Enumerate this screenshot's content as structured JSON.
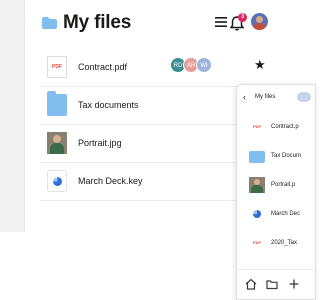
{
  "header": {
    "title": "My files",
    "notification_count": "3"
  },
  "files": [
    {
      "name": "Contract.pdf",
      "type": "pdf",
      "type_label": "PDF",
      "shared_with": [
        "RD",
        "AR",
        "WI"
      ],
      "starred": true
    },
    {
      "name": "Tax documents",
      "type": "folder"
    },
    {
      "name": "Portrait.jpg",
      "type": "image"
    },
    {
      "name": "March Deck.key",
      "type": "keynote"
    }
  ],
  "share_avatar_colors": [
    "#3a8f8f",
    "#e89c9c",
    "#9db4dd"
  ],
  "sidepanel": {
    "breadcrumb": "My files",
    "items": [
      {
        "name": "Contract.p",
        "type_label": "PDF"
      },
      {
        "name": "Tax Docum"
      },
      {
        "name": "Portrait.p"
      },
      {
        "name": "March Dec"
      },
      {
        "name": "2020_Tax",
        "type_label": "PDF"
      }
    ],
    "bottom_icons": [
      "home-icon",
      "folder-icon",
      "plus-icon"
    ]
  },
  "colors": {
    "folder_blue": "#82bdf0",
    "badge_red": "#e0245e",
    "pdf_red": "#e34b3c"
  }
}
